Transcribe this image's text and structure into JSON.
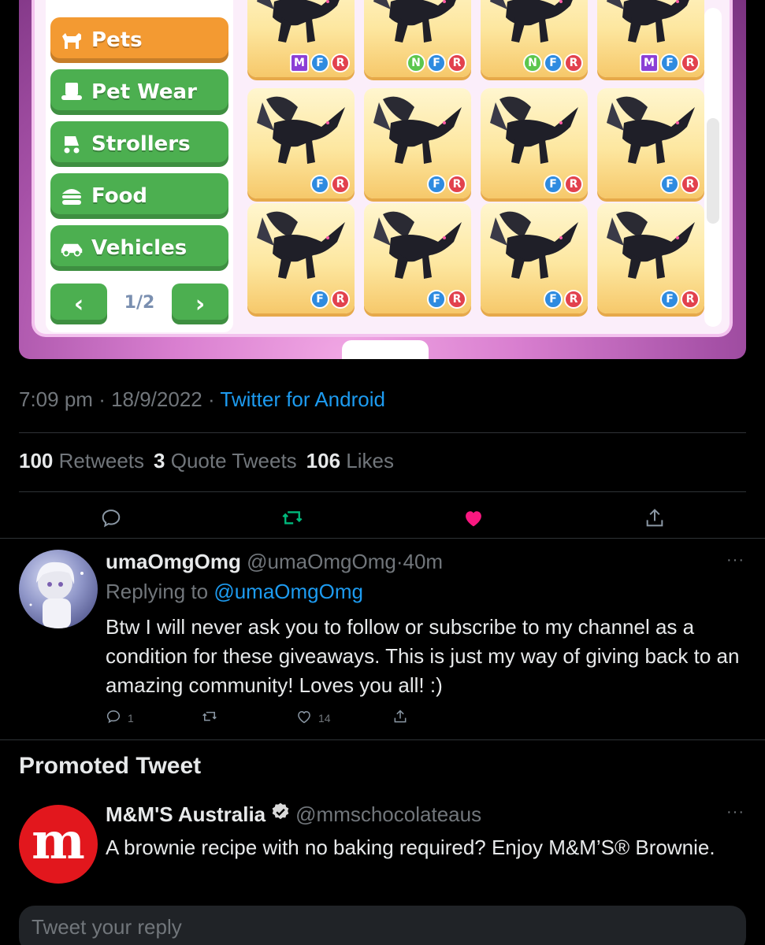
{
  "game": {
    "categories": [
      {
        "label": "Pets",
        "icon": "dog-icon",
        "color": "#f39a32",
        "selected": true
      },
      {
        "label": "Pet Wear",
        "icon": "hat-icon",
        "color": "#4caf50",
        "selected": false
      },
      {
        "label": "Strollers",
        "icon": "stroller-icon",
        "color": "#4caf50",
        "selected": false
      },
      {
        "label": "Food",
        "icon": "burger-icon",
        "color": "#4caf50",
        "selected": false
      },
      {
        "label": "Vehicles",
        "icon": "car-icon",
        "color": "#4caf50",
        "selected": false
      }
    ],
    "pager": {
      "label": "1/2",
      "prev": "‹",
      "next": "›"
    },
    "badges_row1": [
      [
        "M",
        "F",
        "R"
      ],
      [
        "N",
        "F",
        "R"
      ],
      [
        "N",
        "F",
        "R"
      ],
      [
        "M",
        "F",
        "R"
      ]
    ],
    "badges_row2": [
      [
        "F",
        "R"
      ],
      [
        "F",
        "R"
      ],
      [
        "F",
        "R"
      ],
      [
        "F",
        "R"
      ]
    ],
    "badges_row3": [
      [
        "F",
        "R"
      ],
      [
        "F",
        "R"
      ],
      [
        "F",
        "R"
      ],
      [
        "F",
        "R"
      ]
    ]
  },
  "tweet": {
    "time": "7:09 pm",
    "date": "18/9/2022",
    "source": "Twitter for Android",
    "retweets": "100",
    "retweets_label": "Retweets",
    "quotes": "3",
    "quotes_label": "Quote Tweets",
    "likes": "106",
    "likes_label": "Likes"
  },
  "reply": {
    "name": "umaOmgOmg",
    "handle": "@umaOmgOmg",
    "age": "40m",
    "replying_prefix": "Replying to",
    "replying_to": "@umaOmgOmg",
    "body": "Btw I will never ask you to follow or subscribe to my channel as a condition for these giveaways.  This is just my way of giving back to an amazing community!  Loves you all!  :)",
    "reply_count": "1",
    "like_count": "14",
    "more": "···"
  },
  "promoted": {
    "heading": "Promoted Tweet",
    "name": "M&M'S Australia",
    "handle": "@mmschocolateaus",
    "avatar_letter": "m",
    "body": "A brownie recipe with no baking required? Enjoy M&M’S® Brownie.",
    "more": "···"
  },
  "composer": {
    "placeholder": "Tweet your reply"
  },
  "colors": {
    "accent": "#1d9bf0",
    "like": "#f91880",
    "retweet": "#00ba7c",
    "brand_red": "#e2171d"
  }
}
